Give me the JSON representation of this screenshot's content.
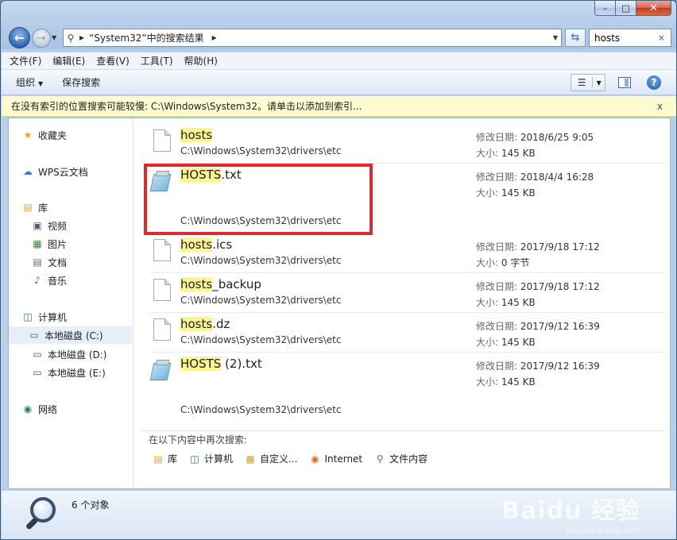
{
  "window": {
    "min": "–",
    "max": "□",
    "close": "✕"
  },
  "address": {
    "location": "“System32”中的搜索结果"
  },
  "search": {
    "value": "hosts",
    "clear": "×"
  },
  "menu": [
    "文件(F)",
    "编辑(E)",
    "查看(V)",
    "工具(T)",
    "帮助(H)"
  ],
  "toolbar": {
    "organize": "组织",
    "save_search": "保存搜索",
    "help": "?"
  },
  "infobar": {
    "text": "在没有索引的位置搜索可能较慢: C:\\Windows\\System32。请单击以添加到索引...",
    "close": "x"
  },
  "nav": {
    "favorites": "收藏夹",
    "wps": "WPS云文档",
    "library": "库",
    "library_items": [
      "视频",
      "图片",
      "文档",
      "音乐"
    ],
    "computer": "计算机",
    "drives": [
      "本地磁盘 (C:)",
      "本地磁盘 (D:)",
      "本地磁盘 (E:)"
    ],
    "network": "网络"
  },
  "files": [
    {
      "hl": "hosts",
      "rest": "",
      "path": "C:\\Windows\\System32\\drivers\\etc",
      "date_label": "修改日期:",
      "date": "2018/6/25 9:05",
      "size_label": "大小:",
      "size": "145 KB",
      "icon": "blank-file-icon"
    },
    {
      "hl": "HOSTS",
      "rest": ".txt",
      "path": "C:\\Windows\\System32\\drivers\\etc",
      "date_label": "修改日期:",
      "date": "2018/4/4 16:28",
      "size_label": "大小:",
      "size": "145 KB",
      "icon": "notepad-file-icon"
    },
    {
      "hl": "hosts",
      "rest": ".ics",
      "path": "C:\\Windows\\System32\\drivers\\etc",
      "date_label": "修改日期:",
      "date": "2017/9/18 17:12",
      "size_label": "大小:",
      "size": "0 字节",
      "icon": "blank-file-icon"
    },
    {
      "hl": "hosts",
      "rest": "_backup",
      "path": "C:\\Windows\\System32\\drivers\\etc",
      "date_label": "修改日期:",
      "date": "2017/9/18 17:12",
      "size_label": "大小:",
      "size": "145 KB",
      "icon": "blank-file-icon"
    },
    {
      "hl": "hosts",
      "rest": ".dz",
      "path": "C:\\Windows\\System32\\drivers\\etc",
      "date_label": "修改日期:",
      "date": "2017/9/12 16:39",
      "size_label": "大小:",
      "size": "145 KB",
      "icon": "blank-file-icon"
    },
    {
      "hl": "HOSTS",
      "rest": " (2).txt",
      "path": "C:\\Windows\\System32\\drivers\\etc",
      "date_label": "修改日期:",
      "date": "2017/9/12 16:39",
      "size_label": "大小:",
      "size": "145 KB",
      "icon": "notepad-file-icon"
    }
  ],
  "research": {
    "label": "在以下内容中再次搜索:",
    "options": [
      "库",
      "计算机",
      "自定义...",
      "Internet",
      "文件内容"
    ]
  },
  "details": {
    "count": "6 个对象"
  },
  "watermark": {
    "brand": "Baidu 经验",
    "url": "jingyan.baidu.com"
  },
  "colors": {
    "highlight": "#fbf592",
    "annotation_box": "#e02a2a",
    "infobar": "#fffbd0"
  }
}
